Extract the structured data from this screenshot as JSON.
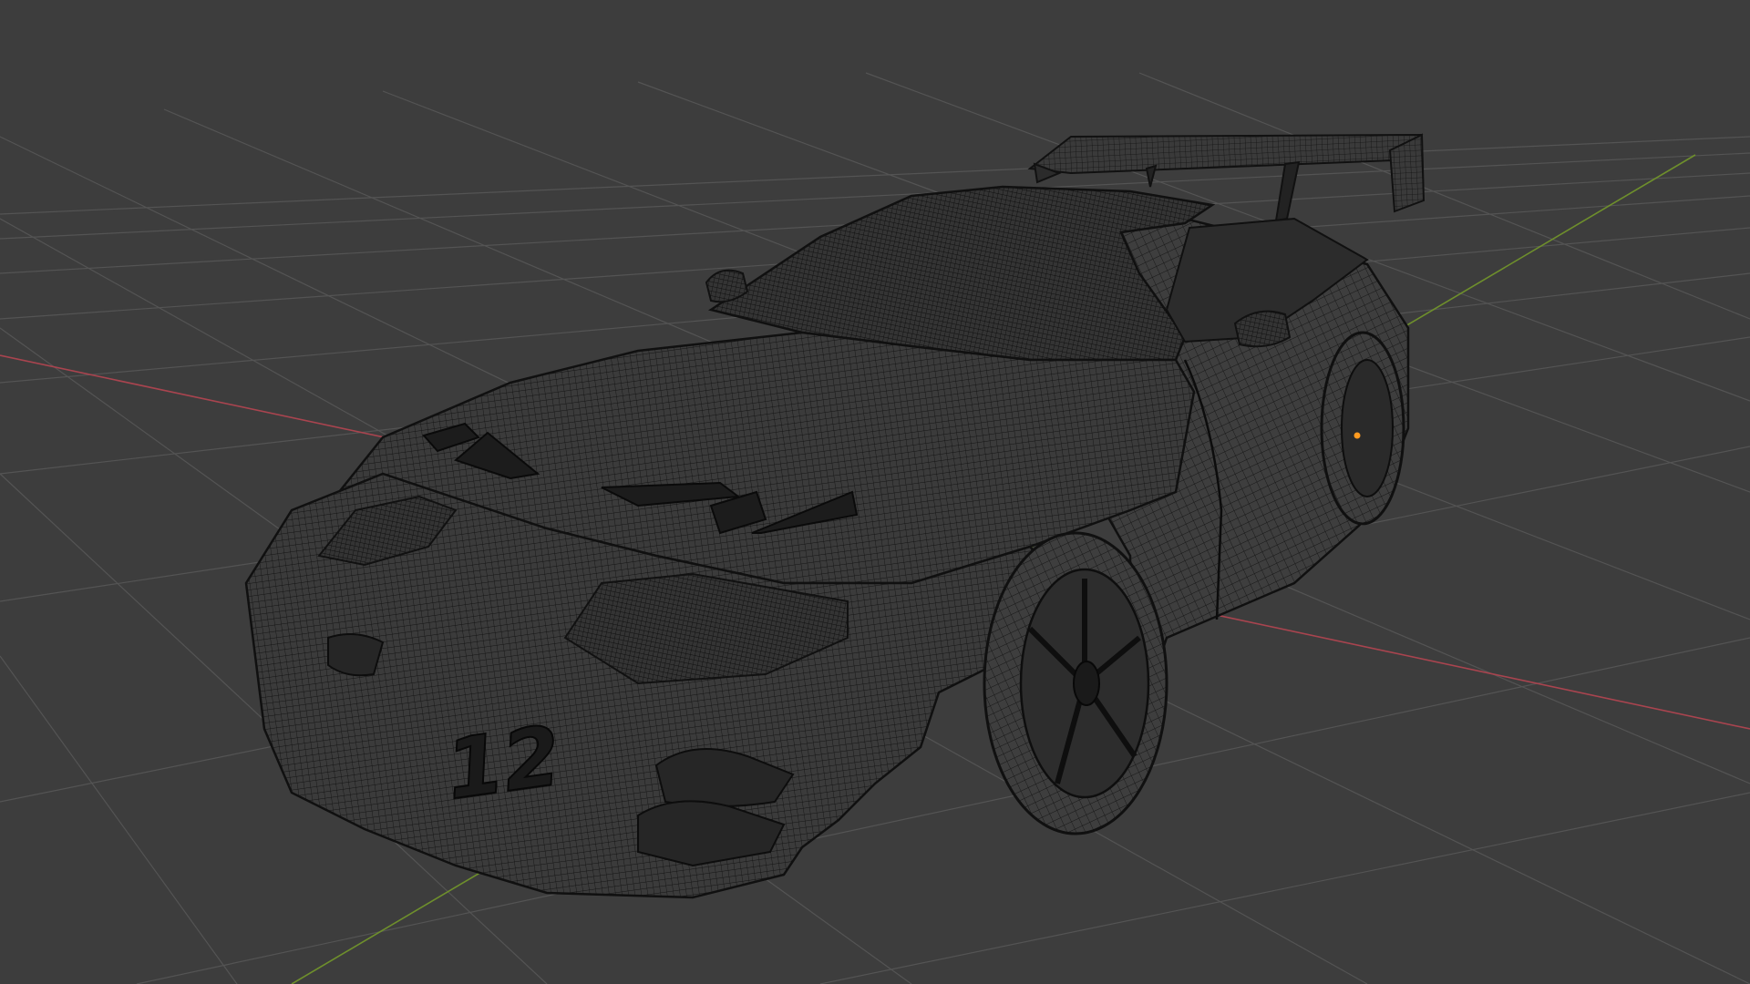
{
  "viewport": {
    "background": "#3d3d3d",
    "grid_color": "#545454",
    "x_axis_color": "#a9444f",
    "y_axis_color": "#6e8f2c",
    "origin_marker_color": "#ff9a1f",
    "shading_mode": "wireframe",
    "object": {
      "wire_color": "#111111",
      "body_fill": "#3a3a3a",
      "decal_text": "12"
    }
  }
}
